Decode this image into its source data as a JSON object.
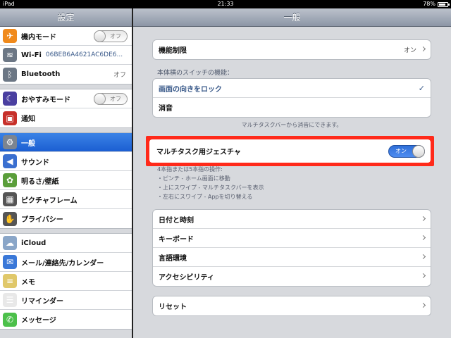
{
  "status": {
    "device": "iPad",
    "time": "21:33",
    "battery": "78%",
    "battery_fraction": 0.78
  },
  "sidebar": {
    "title": "設定",
    "groups": [
      [
        {
          "label": "機内モード",
          "icon": "airplane-icon",
          "icon_color": "#f08a1c",
          "switch": "オフ"
        },
        {
          "label": "Wi-Fi",
          "icon": "wifi-icon",
          "icon_color": "#6c7785",
          "extra": "06BEB6A4621AC6DE6..."
        },
        {
          "label": "Bluetooth",
          "icon": "bluetooth-icon",
          "icon_color": "#6c7785",
          "value": "オフ"
        }
      ],
      [
        {
          "label": "おやすみモード",
          "icon": "moon-icon",
          "icon_color": "#4a3fa0",
          "switch": "オフ"
        },
        {
          "label": "通知",
          "icon": "notification-icon",
          "icon_color": "#c7302a"
        }
      ],
      [
        {
          "label": "一般",
          "icon": "gear-icon",
          "icon_color": "#7b8490",
          "selected": true
        },
        {
          "label": "サウンド",
          "icon": "speaker-icon",
          "icon_color": "#3a6fd0"
        },
        {
          "label": "明るさ/壁紙",
          "icon": "flower-icon",
          "icon_color": "#5a9e3a"
        },
        {
          "label": "ピクチャフレーム",
          "icon": "picture-frame-icon",
          "icon_color": "#555"
        },
        {
          "label": "プライバシー",
          "icon": "hand-icon",
          "icon_color": "#555"
        }
      ],
      [
        {
          "label": "iCloud",
          "icon": "cloud-icon",
          "icon_color": "#8aa6c8"
        },
        {
          "label": "メール/連絡先/カレンダー",
          "icon": "mail-icon",
          "icon_color": "#3a78d8"
        },
        {
          "label": "メモ",
          "icon": "notes-icon",
          "icon_color": "#e0c86a"
        },
        {
          "label": "リマインダー",
          "icon": "reminders-icon",
          "icon_color": "#e8e8e8"
        },
        {
          "label": "メッセージ",
          "icon": "messages-icon",
          "icon_color": "#4cc04a"
        }
      ]
    ]
  },
  "main": {
    "title": "一般",
    "restrictions": {
      "label": "機能制限",
      "value": "オン"
    },
    "side_switch": {
      "title": "本体横のスイッチの機能：",
      "option1": "画面の向きをロック",
      "option2": "消音",
      "footer": "マルチタスクバーから消音にできます。"
    },
    "multitask": {
      "label": "マルチタスク用ジェスチャ",
      "switch": "オン"
    },
    "help": [
      "4本指または5本指の操作:",
      "・ピンチ - ホーム画面に移動",
      "・上にスワイプ - マルチタスクバーを表示",
      "・左右にスワイプ - Appを切り替える"
    ],
    "group3": [
      "日付と時刻",
      "キーボード",
      "言語環境",
      "アクセシビリティ"
    ],
    "reset": "リセット"
  }
}
